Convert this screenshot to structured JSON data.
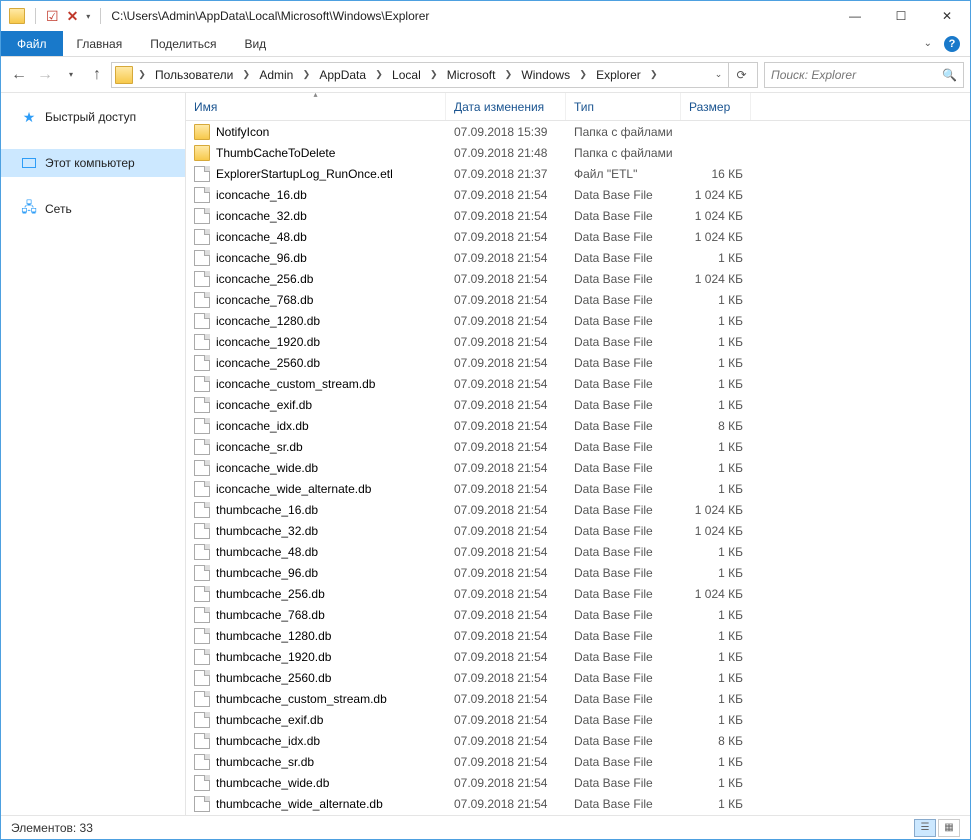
{
  "title_path": "C:\\Users\\Admin\\AppData\\Local\\Microsoft\\Windows\\Explorer",
  "tabs": {
    "file": "Файл",
    "home": "Главная",
    "share": "Поделиться",
    "view": "Вид"
  },
  "breadcrumbs": [
    "Пользователи",
    "Admin",
    "AppData",
    "Local",
    "Microsoft",
    "Windows",
    "Explorer"
  ],
  "search_placeholder": "Поиск: Explorer",
  "side": {
    "quick": "Быстрый доступ",
    "pc": "Этот компьютер",
    "net": "Сеть"
  },
  "columns": {
    "name": "Имя",
    "date": "Дата изменения",
    "type": "Тип",
    "size": "Размер"
  },
  "rows": [
    {
      "icon": "folder",
      "name": "NotifyIcon",
      "date": "07.09.2018 15:39",
      "type": "Папка с файлами",
      "size": ""
    },
    {
      "icon": "folder",
      "name": "ThumbCacheToDelete",
      "date": "07.09.2018 21:48",
      "type": "Папка с файлами",
      "size": ""
    },
    {
      "icon": "file",
      "name": "ExplorerStartupLog_RunOnce.etl",
      "date": "07.09.2018 21:37",
      "type": "Файл \"ETL\"",
      "size": "16 КБ"
    },
    {
      "icon": "file",
      "name": "iconcache_16.db",
      "date": "07.09.2018 21:54",
      "type": "Data Base File",
      "size": "1 024 КБ"
    },
    {
      "icon": "file",
      "name": "iconcache_32.db",
      "date": "07.09.2018 21:54",
      "type": "Data Base File",
      "size": "1 024 КБ"
    },
    {
      "icon": "file",
      "name": "iconcache_48.db",
      "date": "07.09.2018 21:54",
      "type": "Data Base File",
      "size": "1 024 КБ"
    },
    {
      "icon": "file",
      "name": "iconcache_96.db",
      "date": "07.09.2018 21:54",
      "type": "Data Base File",
      "size": "1 КБ"
    },
    {
      "icon": "file",
      "name": "iconcache_256.db",
      "date": "07.09.2018 21:54",
      "type": "Data Base File",
      "size": "1 024 КБ"
    },
    {
      "icon": "file",
      "name": "iconcache_768.db",
      "date": "07.09.2018 21:54",
      "type": "Data Base File",
      "size": "1 КБ"
    },
    {
      "icon": "file",
      "name": "iconcache_1280.db",
      "date": "07.09.2018 21:54",
      "type": "Data Base File",
      "size": "1 КБ"
    },
    {
      "icon": "file",
      "name": "iconcache_1920.db",
      "date": "07.09.2018 21:54",
      "type": "Data Base File",
      "size": "1 КБ"
    },
    {
      "icon": "file",
      "name": "iconcache_2560.db",
      "date": "07.09.2018 21:54",
      "type": "Data Base File",
      "size": "1 КБ"
    },
    {
      "icon": "file",
      "name": "iconcache_custom_stream.db",
      "date": "07.09.2018 21:54",
      "type": "Data Base File",
      "size": "1 КБ"
    },
    {
      "icon": "file",
      "name": "iconcache_exif.db",
      "date": "07.09.2018 21:54",
      "type": "Data Base File",
      "size": "1 КБ"
    },
    {
      "icon": "file",
      "name": "iconcache_idx.db",
      "date": "07.09.2018 21:54",
      "type": "Data Base File",
      "size": "8 КБ"
    },
    {
      "icon": "file",
      "name": "iconcache_sr.db",
      "date": "07.09.2018 21:54",
      "type": "Data Base File",
      "size": "1 КБ"
    },
    {
      "icon": "file",
      "name": "iconcache_wide.db",
      "date": "07.09.2018 21:54",
      "type": "Data Base File",
      "size": "1 КБ"
    },
    {
      "icon": "file",
      "name": "iconcache_wide_alternate.db",
      "date": "07.09.2018 21:54",
      "type": "Data Base File",
      "size": "1 КБ"
    },
    {
      "icon": "file",
      "name": "thumbcache_16.db",
      "date": "07.09.2018 21:54",
      "type": "Data Base File",
      "size": "1 024 КБ"
    },
    {
      "icon": "file",
      "name": "thumbcache_32.db",
      "date": "07.09.2018 21:54",
      "type": "Data Base File",
      "size": "1 024 КБ"
    },
    {
      "icon": "file",
      "name": "thumbcache_48.db",
      "date": "07.09.2018 21:54",
      "type": "Data Base File",
      "size": "1 КБ"
    },
    {
      "icon": "file",
      "name": "thumbcache_96.db",
      "date": "07.09.2018 21:54",
      "type": "Data Base File",
      "size": "1 КБ"
    },
    {
      "icon": "file",
      "name": "thumbcache_256.db",
      "date": "07.09.2018 21:54",
      "type": "Data Base File",
      "size": "1 024 КБ"
    },
    {
      "icon": "file",
      "name": "thumbcache_768.db",
      "date": "07.09.2018 21:54",
      "type": "Data Base File",
      "size": "1 КБ"
    },
    {
      "icon": "file",
      "name": "thumbcache_1280.db",
      "date": "07.09.2018 21:54",
      "type": "Data Base File",
      "size": "1 КБ"
    },
    {
      "icon": "file",
      "name": "thumbcache_1920.db",
      "date": "07.09.2018 21:54",
      "type": "Data Base File",
      "size": "1 КБ"
    },
    {
      "icon": "file",
      "name": "thumbcache_2560.db",
      "date": "07.09.2018 21:54",
      "type": "Data Base File",
      "size": "1 КБ"
    },
    {
      "icon": "file",
      "name": "thumbcache_custom_stream.db",
      "date": "07.09.2018 21:54",
      "type": "Data Base File",
      "size": "1 КБ"
    },
    {
      "icon": "file",
      "name": "thumbcache_exif.db",
      "date": "07.09.2018 21:54",
      "type": "Data Base File",
      "size": "1 КБ"
    },
    {
      "icon": "file",
      "name": "thumbcache_idx.db",
      "date": "07.09.2018 21:54",
      "type": "Data Base File",
      "size": "8 КБ"
    },
    {
      "icon": "file",
      "name": "thumbcache_sr.db",
      "date": "07.09.2018 21:54",
      "type": "Data Base File",
      "size": "1 КБ"
    },
    {
      "icon": "file",
      "name": "thumbcache_wide.db",
      "date": "07.09.2018 21:54",
      "type": "Data Base File",
      "size": "1 КБ"
    },
    {
      "icon": "file",
      "name": "thumbcache_wide_alternate.db",
      "date": "07.09.2018 21:54",
      "type": "Data Base File",
      "size": "1 КБ"
    }
  ],
  "status": "Элементов: 33"
}
